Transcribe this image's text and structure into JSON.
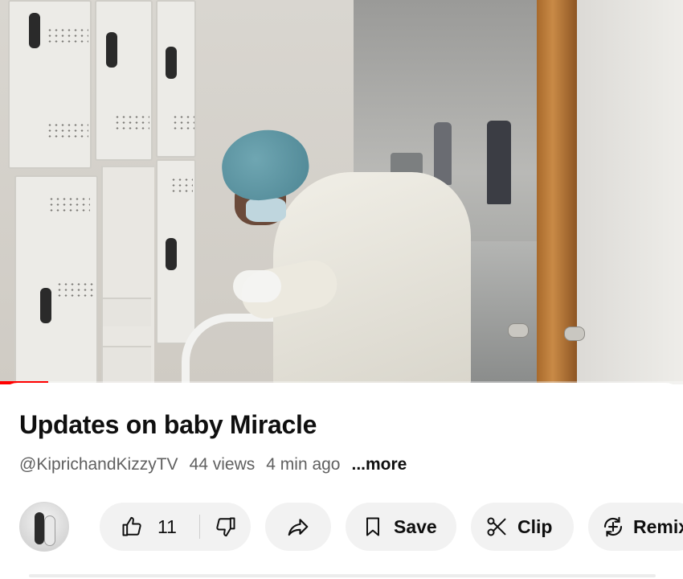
{
  "video": {
    "progress_fraction": 0.07
  },
  "info": {
    "title": "Updates on baby Miracle",
    "channel": "@KiprichandKizzyTV",
    "views": "44 views",
    "age": "4 min ago",
    "more_label": "...more"
  },
  "actions": {
    "like_count": "11",
    "save_label": "Save",
    "clip_label": "Clip",
    "remix_label": "Remix"
  },
  "icons": {
    "like": "thumbs-up-icon",
    "dislike": "thumbs-down-icon",
    "share": "share-arrow-icon",
    "save": "bookmark-icon",
    "clip": "scissors-icon",
    "remix": "remix-icon"
  },
  "colors": {
    "progress": "#ff0000",
    "pill_bg": "#f2f2f2",
    "meta_text": "#606060"
  }
}
